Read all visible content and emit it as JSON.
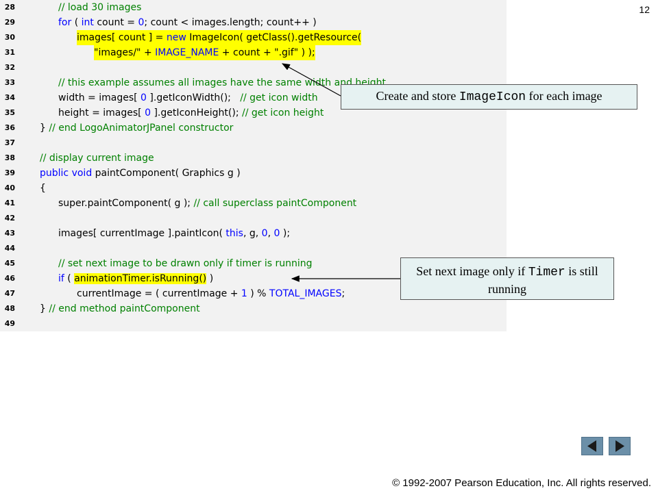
{
  "page_number": "12",
  "copyright": "© 1992-2007 Pearson Education, Inc.  All rights reserved.",
  "code_lines": [
    {
      "num": "28",
      "indent": 2,
      "segs": [
        {
          "t": "// load 30 images",
          "c": "cm"
        }
      ]
    },
    {
      "num": "29",
      "indent": 2,
      "segs": [
        {
          "t": "for",
          "c": "kw"
        },
        {
          "t": " ( ",
          "c": "plain"
        },
        {
          "t": "int",
          "c": "kw"
        },
        {
          "t": " count = ",
          "c": "plain"
        },
        {
          "t": "0",
          "c": "num"
        },
        {
          "t": "; count < images.length; count++ )",
          "c": "plain"
        }
      ]
    },
    {
      "num": "30",
      "indent": 3,
      "hl": true,
      "segs": [
        {
          "t": "images[ count ] = ",
          "c": "plain"
        },
        {
          "t": "new",
          "c": "kw"
        },
        {
          "t": " ImageIcon( getClass().getResource(",
          "c": "plain"
        }
      ]
    },
    {
      "num": "31",
      "indent": 4,
      "hl": true,
      "segs": [
        {
          "t": "\"images/\"",
          "c": "str"
        },
        {
          "t": " + ",
          "c": "plain"
        },
        {
          "t": "IMAGE_NAME",
          "c": "const"
        },
        {
          "t": " + count + ",
          "c": "plain"
        },
        {
          "t": "\".gif\"",
          "c": "str"
        },
        {
          "t": " ) );",
          "c": "plain"
        }
      ]
    },
    {
      "num": "32",
      "indent": 0,
      "segs": []
    },
    {
      "num": "33",
      "indent": 2,
      "segs": [
        {
          "t": "// this example assumes all images have the same width and height",
          "c": "cm"
        }
      ]
    },
    {
      "num": "34",
      "indent": 2,
      "segs": [
        {
          "t": "width = images[ ",
          "c": "plain"
        },
        {
          "t": "0",
          "c": "num"
        },
        {
          "t": " ].getIconWidth();   ",
          "c": "plain"
        },
        {
          "t": "// get icon width",
          "c": "cm"
        }
      ]
    },
    {
      "num": "35",
      "indent": 2,
      "segs": [
        {
          "t": "height = images[ ",
          "c": "plain"
        },
        {
          "t": "0",
          "c": "num"
        },
        {
          "t": " ].getIconHeight(); ",
          "c": "plain"
        },
        {
          "t": "// get icon height",
          "c": "cm"
        }
      ]
    },
    {
      "num": "36",
      "indent": 1,
      "segs": [
        {
          "t": "} ",
          "c": "plain"
        },
        {
          "t": "// end LogoAnimatorJPanel constructor",
          "c": "cm"
        }
      ]
    },
    {
      "num": "37",
      "indent": 0,
      "segs": []
    },
    {
      "num": "38",
      "indent": 1,
      "segs": [
        {
          "t": "// display current image",
          "c": "cm"
        }
      ]
    },
    {
      "num": "39",
      "indent": 1,
      "segs": [
        {
          "t": "public",
          "c": "kw"
        },
        {
          "t": " ",
          "c": "plain"
        },
        {
          "t": "void",
          "c": "kw"
        },
        {
          "t": " paintComponent( Graphics g )",
          "c": "plain"
        }
      ]
    },
    {
      "num": "40",
      "indent": 1,
      "segs": [
        {
          "t": "{",
          "c": "plain"
        }
      ]
    },
    {
      "num": "41",
      "indent": 2,
      "segs": [
        {
          "t": "super",
          "c": "plain"
        },
        {
          "t": ".paintComponent( g ); ",
          "c": "plain"
        },
        {
          "t": "// call superclass paintComponent",
          "c": "cm"
        }
      ]
    },
    {
      "num": "42",
      "indent": 0,
      "segs": []
    },
    {
      "num": "43",
      "indent": 2,
      "segs": [
        {
          "t": "images[ currentImage ].paintIcon( ",
          "c": "plain"
        },
        {
          "t": "this",
          "c": "kw"
        },
        {
          "t": ", g, ",
          "c": "plain"
        },
        {
          "t": "0",
          "c": "num"
        },
        {
          "t": ", ",
          "c": "plain"
        },
        {
          "t": "0",
          "c": "num"
        },
        {
          "t": " );",
          "c": "plain"
        }
      ]
    },
    {
      "num": "44",
      "indent": 0,
      "segs": []
    },
    {
      "num": "45",
      "indent": 2,
      "segs": [
        {
          "t": "// set next image to be drawn only if timer is running",
          "c": "cm"
        }
      ]
    },
    {
      "num": "46",
      "indent": 2,
      "segs": [
        {
          "t": "if",
          "c": "kw"
        },
        {
          "t": " ( ",
          "c": "plain"
        },
        {
          "t": "animationTimer.isRunning()",
          "c": "plain",
          "hl": true
        },
        {
          "t": " )",
          "c": "plain"
        }
      ]
    },
    {
      "num": "47",
      "indent": 3,
      "segs": [
        {
          "t": "currentImage = ( currentImage + ",
          "c": "plain"
        },
        {
          "t": "1",
          "c": "num"
        },
        {
          "t": " ) % ",
          "c": "plain"
        },
        {
          "t": "TOTAL_IMAGES",
          "c": "const"
        },
        {
          "t": ";",
          "c": "plain"
        }
      ]
    },
    {
      "num": "48",
      "indent": 1,
      "segs": [
        {
          "t": "} ",
          "c": "plain"
        },
        {
          "t": "// end method paintComponent",
          "c": "cm"
        }
      ]
    },
    {
      "num": "49",
      "indent": 0,
      "segs": []
    }
  ],
  "callout_1": {
    "before": "Create and store ",
    "mono": "ImageIcon",
    "after": " for each image"
  },
  "callout_2": {
    "before": "Set next image only if ",
    "mono": "Timer",
    "after": " is still running"
  },
  "nav": {
    "prev": "previous-slide",
    "next": "next-slide"
  }
}
